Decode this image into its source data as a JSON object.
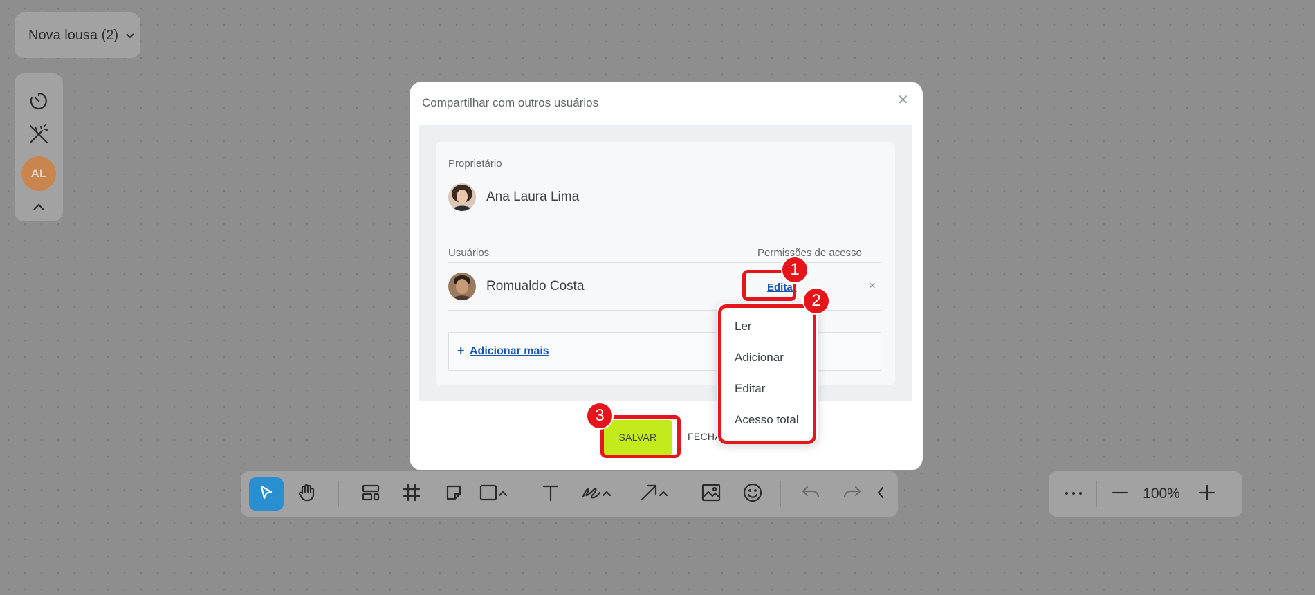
{
  "board": {
    "title": "Nova lousa (2)"
  },
  "left_bar": {
    "icons": [
      "timer-icon",
      "magic-wand-off-icon",
      "collapse-up-icon"
    ],
    "avatar_initials": "AL"
  },
  "toolbar": {
    "tools": [
      "select-icon",
      "hand-icon",
      "templates-icon",
      "frame-icon",
      "sticky-note-icon",
      "rectangle-icon",
      "text-icon",
      "pen-icon",
      "arrow-icon",
      "image-icon",
      "emoji-icon",
      "undo-icon",
      "redo-icon",
      "collapse-left-icon"
    ],
    "active_tool": "select"
  },
  "zoom": {
    "value": "100%",
    "more_icon": "more-icon",
    "minus_icon": "zoom-out-icon",
    "plus_icon": "zoom-in-icon"
  },
  "modal": {
    "title": "Compartilhar com outros usuários",
    "close_icon": "close-icon",
    "owner_label": "Proprietário",
    "owner_name": "Ana Laura Lima",
    "users_label": "Usuários",
    "permissions_label": "Permissões de acesso",
    "user_name": "Romualdo Costa",
    "user_permission": "Editar",
    "remove_icon": "×",
    "add_more_label": "Adicionar mais",
    "add_more_plus": "+",
    "save_label": "SALVAR",
    "close_label": "FECHAR"
  },
  "dropdown": {
    "options": [
      "Ler",
      "Adicionar",
      "Editar",
      "Acesso total"
    ]
  },
  "annotations": {
    "badge_1": "1",
    "badge_2": "2",
    "badge_3": "3",
    "color": "#e4161c"
  },
  "colors": {
    "save_button": "#c3ea1a",
    "active_tool": "#2a8fd0",
    "link": "#1a56b0",
    "avatar": "#c9854e"
  }
}
